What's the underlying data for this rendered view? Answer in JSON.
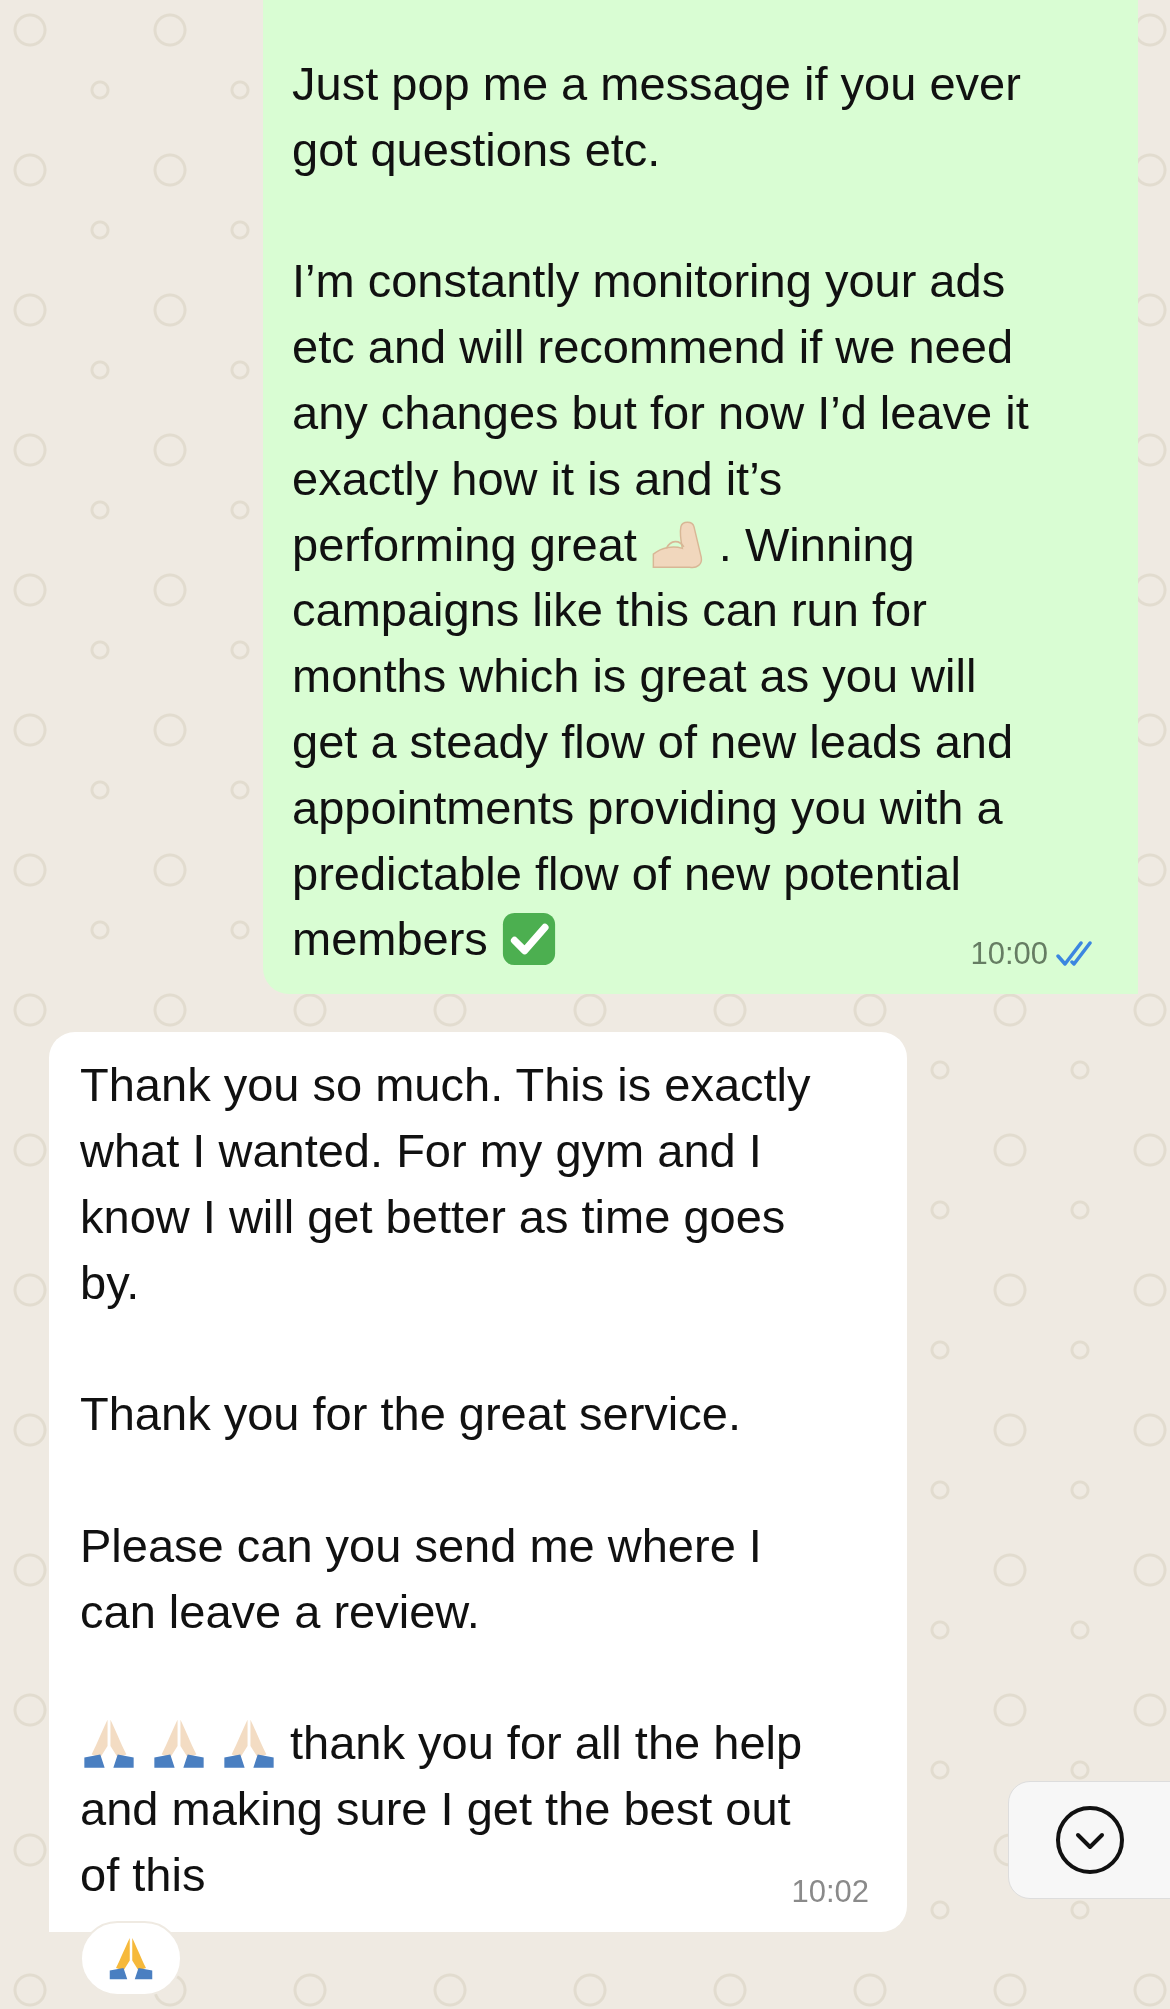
{
  "messages": [
    {
      "kind": "outgoing",
      "time": "10:00",
      "read": true,
      "paragraphs": [
        {
          "lines": [
            {
              "text": "Just pop me a message if you ever"
            },
            {
              "text": "got questions etc."
            }
          ]
        },
        {
          "lines": [
            {
              "text": "I’m constantly monitoring your ads"
            },
            {
              "text": "etc and will recommend if we need"
            },
            {
              "text": "any changes but for now I’d leave it"
            },
            {
              "text": "exactly how it is and it’s"
            },
            {
              "parts": [
                {
                  "kind": "text",
                  "text": "performing great"
                },
                {
                  "kind": "flexed-arm"
                },
                {
                  "kind": "text",
                  "text": ". Winning"
                }
              ]
            },
            {
              "text": "campaigns like this can run for"
            },
            {
              "text": "months which is great as you will"
            },
            {
              "text": "get a steady flow of new leads and"
            },
            {
              "text": "appointments providing you with a"
            },
            {
              "text": "predictable flow of new potential"
            },
            {
              "parts": [
                {
                  "kind": "text",
                  "text": "members"
                },
                {
                  "kind": "check-mark"
                }
              ]
            }
          ]
        }
      ]
    },
    {
      "kind": "incoming",
      "time": "10:02",
      "reaction": {
        "kind": "praying-hands"
      },
      "paragraphs": [
        {
          "lines": [
            {
              "text": "Thank you so much. This is exactly"
            },
            {
              "text": "what I wanted. For my gym and I"
            },
            {
              "text": "know I will get better as time goes"
            },
            {
              "text": "by."
            }
          ]
        },
        {
          "lines": [
            {
              "text": "Thank you for the great service."
            }
          ]
        },
        {
          "lines": [
            {
              "text": "Please can you send me where I"
            },
            {
              "text": "can leave a review."
            }
          ]
        },
        {
          "lines": [
            {
              "parts": [
                {
                  "kind": "praying-hands-light"
                },
                {
                  "kind": "praying-hands-light"
                },
                {
                  "kind": "praying-hands-light"
                },
                {
                  "kind": "text",
                  "text": "thank you for all the help"
                }
              ]
            },
            {
              "text": "and making sure I get the best out"
            },
            {
              "text": "of this"
            }
          ]
        }
      ]
    }
  ]
}
